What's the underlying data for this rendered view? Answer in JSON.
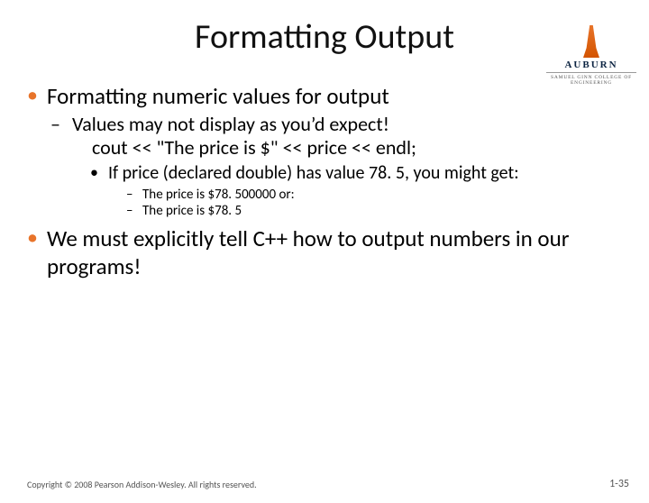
{
  "logo": {
    "name": "AUBURN",
    "sub": "SAMUEL GINN COLLEGE OF ENGINEERING"
  },
  "title": "Formatting Output",
  "b1": {
    "text": "Formatting numeric values for output",
    "s1": {
      "line1": "Values may not display as you’d expect!",
      "line2": "cout << \"The price is $\" << price << endl;"
    },
    "s2": {
      "text": "If price (declared double) has value 78. 5, you might get:",
      "ex1": "The price is $78. 500000   or:",
      "ex2": "The price is $78. 5"
    }
  },
  "b2": "We must explicitly tell C++ how to output numbers in our programs!",
  "footer": "Copyright © 2008 Pearson Addison-Wesley. All rights reserved.",
  "pagenum": "1-35"
}
